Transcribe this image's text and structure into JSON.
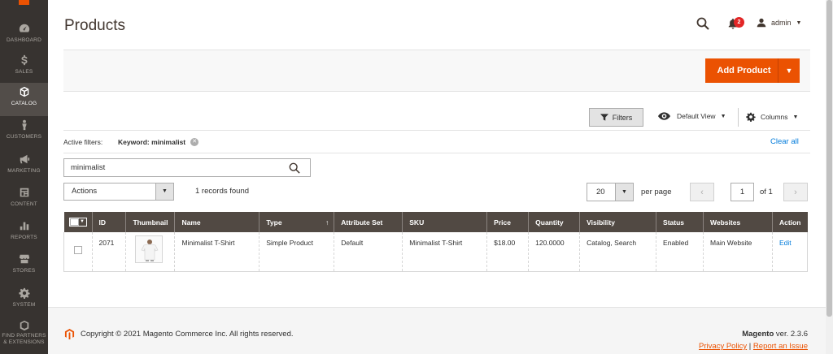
{
  "sidebar": {
    "items": [
      {
        "label": "DASHBOARD",
        "icon": "dashboard-icon"
      },
      {
        "label": "SALES",
        "icon": "dollar-icon"
      },
      {
        "label": "CATALOG",
        "icon": "box-icon",
        "active": true
      },
      {
        "label": "CUSTOMERS",
        "icon": "person-icon"
      },
      {
        "label": "MARKETING",
        "icon": "megaphone-icon"
      },
      {
        "label": "CONTENT",
        "icon": "content-icon"
      },
      {
        "label": "REPORTS",
        "icon": "bar-chart-icon"
      },
      {
        "label": "STORES",
        "icon": "store-icon"
      },
      {
        "label": "SYSTEM",
        "icon": "gear-icon"
      },
      {
        "label": "FIND PARTNERS & EXTENSIONS",
        "icon": "extensions-icon"
      }
    ]
  },
  "header": {
    "title": "Products",
    "notification_count": "2",
    "user_name": "admin"
  },
  "toolbar": {
    "add_product_label": "Add Product",
    "filters_label": "Filters",
    "view_label": "Default View",
    "columns_label": "Columns"
  },
  "active_filters": {
    "label": "Active filters:",
    "chip": "Keyword: minimalist",
    "clear_all": "Clear all"
  },
  "search": {
    "value": "minimalist"
  },
  "grid_controls": {
    "actions_label": "Actions",
    "records_found": "1 records found",
    "per_page_value": "20",
    "per_page_label": "per page",
    "current_page": "1",
    "total_pages_label": "of 1"
  },
  "table": {
    "columns": [
      "ID",
      "Thumbnail",
      "Name",
      "Type",
      "Attribute Set",
      "SKU",
      "Price",
      "Quantity",
      "Visibility",
      "Status",
      "Websites",
      "Action"
    ],
    "sort_indicator": "↑",
    "rows": [
      {
        "id": "2071",
        "name": "Minimalist T-Shirt",
        "type": "Simple Product",
        "attribute_set": "Default",
        "sku": "Minimalist T-Shirt",
        "price": "$18.00",
        "quantity": "120.0000",
        "visibility": "Catalog, Search",
        "status": "Enabled",
        "websites": "Main Website",
        "action": "Edit"
      }
    ]
  },
  "footer": {
    "copyright": "Copyright © 2021 Magento Commerce Inc. All rights reserved.",
    "brand": "Magento",
    "version": " ver. 2.3.6",
    "privacy": "Privacy Policy",
    "separator": " | ",
    "report": "Report an Issue"
  },
  "colors": {
    "accent": "#eb5202",
    "sidebar_bg": "#373330",
    "table_header_bg": "#514943",
    "link": "#007bdb"
  }
}
